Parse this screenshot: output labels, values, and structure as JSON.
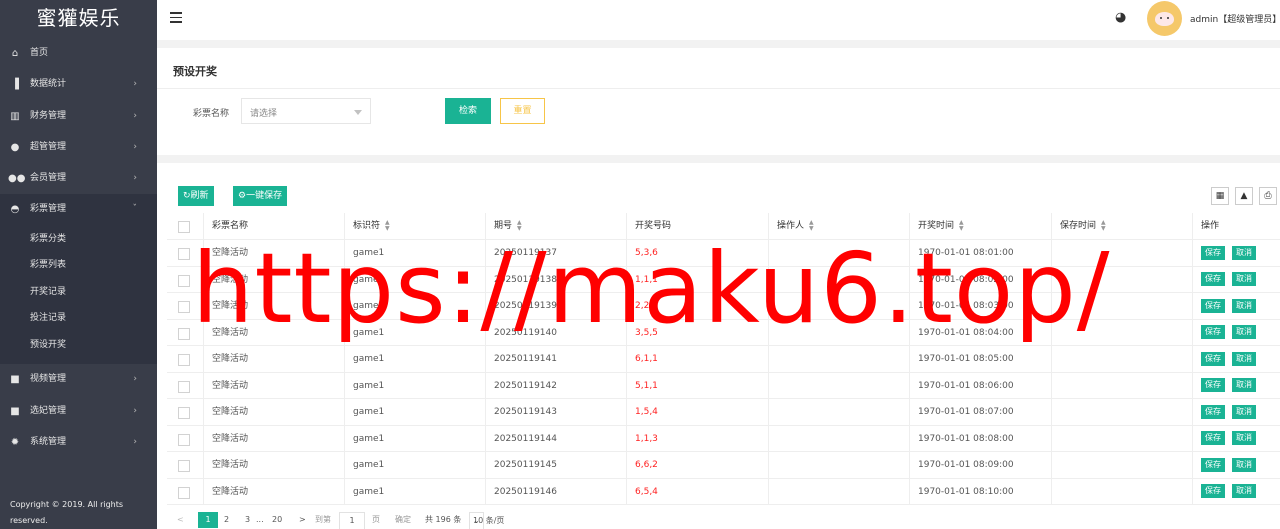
{
  "app": {
    "title": "蜜獾娱乐",
    "copyright": "Copyright © 2019. All rights reserved."
  },
  "sidebar": {
    "items": [
      {
        "label": "首页",
        "icon": "home-icon",
        "has_arrow": false
      },
      {
        "label": "数据统计",
        "icon": "bar-chart-icon",
        "has_arrow": true
      },
      {
        "label": "财务管理",
        "icon": "bank-icon",
        "has_arrow": true
      },
      {
        "label": "超管管理",
        "icon": "user-icon",
        "has_arrow": true
      },
      {
        "label": "会员管理",
        "icon": "users-icon",
        "has_arrow": true
      },
      {
        "label": "彩票管理",
        "icon": "gamepad-icon",
        "has_arrow": true,
        "open": true,
        "children": [
          "彩票分类",
          "彩票列表",
          "开奖记录",
          "投注记录",
          "预设开奖"
        ]
      },
      {
        "label": "视频管理",
        "icon": "video-icon",
        "has_arrow": true
      },
      {
        "label": "选妃管理",
        "icon": "video-icon",
        "has_arrow": true
      },
      {
        "label": "系统管理",
        "icon": "gear-icon",
        "has_arrow": true
      }
    ]
  },
  "header": {
    "user": "admin【超级管理员】",
    "palette_icon": "palette-icon"
  },
  "search": {
    "title": "预设开奖",
    "field_label": "彩票名称",
    "select_placeholder": "请选择",
    "search_button": "检索",
    "reset_button": "重置"
  },
  "toolbar": {
    "refresh": "刷新",
    "save_all": "一键保存"
  },
  "table": {
    "columns": [
      "彩票名称",
      "标识符",
      "期号",
      "开奖号码",
      "操作人",
      "开奖时间",
      "保存时间",
      "操作"
    ],
    "save_label": "保存",
    "cancel_label": "取消",
    "rows": [
      {
        "name": "空降活动",
        "key": "game1",
        "issue": "20250119137",
        "numbers": "5,3,6",
        "operator": "",
        "draw_time": "1970-01-01 08:01:00",
        "save_time": ""
      },
      {
        "name": "空降活动",
        "key": "game1",
        "issue": "20250119138",
        "numbers": "1,1,1",
        "operator": "",
        "draw_time": "1970-01-01 08:02:00",
        "save_time": ""
      },
      {
        "name": "空降活动",
        "key": "game1",
        "issue": "20250119139",
        "numbers": "2,2,2",
        "operator": "",
        "draw_time": "1970-01-01 08:03:00",
        "save_time": ""
      },
      {
        "name": "空降活动",
        "key": "game1",
        "issue": "20250119140",
        "numbers": "3,5,5",
        "operator": "",
        "draw_time": "1970-01-01 08:04:00",
        "save_time": ""
      },
      {
        "name": "空降活动",
        "key": "game1",
        "issue": "20250119141",
        "numbers": "6,1,1",
        "operator": "",
        "draw_time": "1970-01-01 08:05:00",
        "save_time": ""
      },
      {
        "name": "空降活动",
        "key": "game1",
        "issue": "20250119142",
        "numbers": "5,1,1",
        "operator": "",
        "draw_time": "1970-01-01 08:06:00",
        "save_time": ""
      },
      {
        "name": "空降活动",
        "key": "game1",
        "issue": "20250119143",
        "numbers": "1,5,4",
        "operator": "",
        "draw_time": "1970-01-01 08:07:00",
        "save_time": ""
      },
      {
        "name": "空降活动",
        "key": "game1",
        "issue": "20250119144",
        "numbers": "1,1,3",
        "operator": "",
        "draw_time": "1970-01-01 08:08:00",
        "save_time": ""
      },
      {
        "name": "空降活动",
        "key": "game1",
        "issue": "20250119145",
        "numbers": "6,6,2",
        "operator": "",
        "draw_time": "1970-01-01 08:09:00",
        "save_time": ""
      },
      {
        "name": "空降活动",
        "key": "game1",
        "issue": "20250119146",
        "numbers": "6,5,4",
        "operator": "",
        "draw_time": "1970-01-01 08:10:00",
        "save_time": ""
      }
    ]
  },
  "pagination": {
    "prev": "<",
    "pages": [
      "1",
      "2",
      "3",
      "...",
      "20"
    ],
    "next": ">",
    "goto_label": "到第",
    "goto_value": "1",
    "page_unit": "页",
    "confirm": "确定",
    "total": "共 196 条",
    "page_size": "10 条/页"
  },
  "watermark": "https://maku6.top/",
  "colors": {
    "sidebar": "#393d49",
    "accent": "#1ab394",
    "warn": "#f7c548",
    "number": "#ff2222"
  }
}
